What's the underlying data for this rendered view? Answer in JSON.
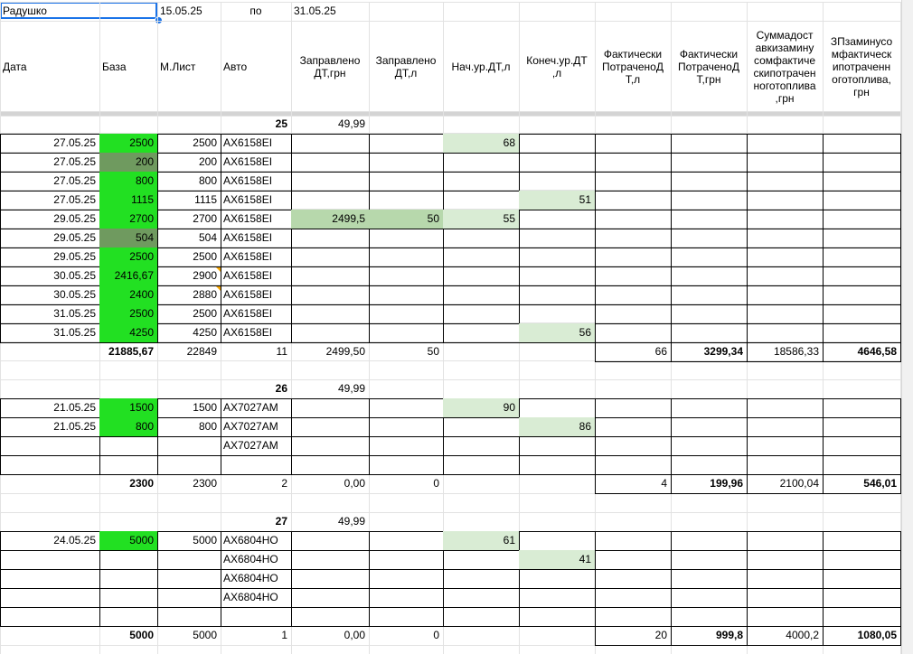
{
  "colors": {
    "grid": "#e2e2e2",
    "base_bright": "#22e022",
    "base_dark": "#6f9a5f",
    "light_fill": "#d9ecd4",
    "mid_fill": "#b7d8ac",
    "selection": "#1a73e8"
  },
  "top": {
    "name": "Радушко",
    "date_from": "15.05.25",
    "sep": "по",
    "date_to": "31.05.25"
  },
  "headers": [
    "Дата",
    "База",
    "М.Лист",
    "Авто",
    "Заправлено ДТ,грн",
    "Заправлено ДТ,л",
    "Нач.ур.ДТ,л",
    "Конеч.ур.ДТ ,л",
    "Фактически ПотраченоД Т,л",
    "Фактически ПотраченоД Т,грн",
    "Суммадост авкизамину сомфактиче скипотрачен ноготоплива ,грн",
    "ЗПзаминусо мфактическ ипотраченн оготоплива, грн"
  ],
  "groups": [
    {
      "number": "25",
      "price": "49,99",
      "rows": [
        {
          "date": "27.05.25",
          "base": "2500",
          "sheet": "2500",
          "auto": "AX6158EI",
          "fuel_uah": "",
          "fuel_l": "",
          "start": "68",
          "end": ""
        },
        {
          "date": "27.05.25",
          "base": "200",
          "sheet": "200",
          "auto": "AX6158EI",
          "fuel_uah": "",
          "fuel_l": "",
          "start": "",
          "end": ""
        },
        {
          "date": "27.05.25",
          "base": "800",
          "sheet": "800",
          "auto": "AX6158EI",
          "fuel_uah": "",
          "fuel_l": "",
          "start": "",
          "end": ""
        },
        {
          "date": "27.05.25",
          "base": "1115",
          "sheet": "1115",
          "auto": "AX6158EI",
          "fuel_uah": "",
          "fuel_l": "",
          "start": "",
          "end": "51"
        },
        {
          "date": "29.05.25",
          "base": "2700",
          "sheet": "2700",
          "auto": "AX6158EI",
          "fuel_uah": "2499,5",
          "fuel_l": "50",
          "start": "55",
          "end": ""
        },
        {
          "date": "29.05.25",
          "base": "504",
          "sheet": "504",
          "auto": "AX6158EI",
          "fuel_uah": "",
          "fuel_l": "",
          "start": "",
          "end": ""
        },
        {
          "date": "29.05.25",
          "base": "2500",
          "sheet": "2500",
          "auto": "AX6158EI",
          "fuel_uah": "",
          "fuel_l": "",
          "start": "",
          "end": ""
        },
        {
          "date": "30.05.25",
          "base": "2416,67",
          "sheet": "2900",
          "auto": "AX6158EI",
          "fuel_uah": "",
          "fuel_l": "",
          "start": "",
          "end": ""
        },
        {
          "date": "30.05.25",
          "base": "2400",
          "sheet": "2880",
          "auto": "AX6158EI",
          "fuel_uah": "",
          "fuel_l": "",
          "start": "",
          "end": ""
        },
        {
          "date": "31.05.25",
          "base": "2500",
          "sheet": "2500",
          "auto": "AX6158EI",
          "fuel_uah": "",
          "fuel_l": "",
          "start": "",
          "end": ""
        },
        {
          "date": "31.05.25",
          "base": "4250",
          "sheet": "4250",
          "auto": "AX6158EI",
          "fuel_uah": "",
          "fuel_l": "",
          "start": "",
          "end": "56"
        }
      ],
      "total": {
        "base": "21885,67",
        "sheet": "22849",
        "count": "11",
        "fuel_uah": "2499,50",
        "fuel_l": "50",
        "spent_l": "66",
        "spent_uah": "3299,34",
        "delivery": "18586,33",
        "salary": "4646,58"
      }
    },
    {
      "number": "26",
      "price": "49,99",
      "rows": [
        {
          "date": "21.05.25",
          "base": "1500",
          "sheet": "1500",
          "auto": "AX7027AM",
          "fuel_uah": "",
          "fuel_l": "",
          "start": "90",
          "end": ""
        },
        {
          "date": "21.05.25",
          "base": "800",
          "sheet": "800",
          "auto": "AX7027AM",
          "fuel_uah": "",
          "fuel_l": "",
          "start": "",
          "end": "86"
        },
        {
          "date": "",
          "base": "",
          "sheet": "",
          "auto": "AX7027AM",
          "fuel_uah": "",
          "fuel_l": "",
          "start": "",
          "end": ""
        },
        {
          "date": "",
          "base": "",
          "sheet": "",
          "auto": "",
          "fuel_uah": "",
          "fuel_l": "",
          "start": "",
          "end": ""
        }
      ],
      "total": {
        "base": "2300",
        "sheet": "2300",
        "count": "2",
        "fuel_uah": "0,00",
        "fuel_l": "0",
        "spent_l": "4",
        "spent_uah": "199,96",
        "delivery": "2100,04",
        "salary": "546,01"
      }
    },
    {
      "number": "27",
      "price": "49,99",
      "rows": [
        {
          "date": "24.05.25",
          "base": "5000",
          "sheet": "5000",
          "auto": "AX6804HO",
          "fuel_uah": "",
          "fuel_l": "",
          "start": "61",
          "end": ""
        },
        {
          "date": "",
          "base": "",
          "sheet": "",
          "auto": "AX6804HO",
          "fuel_uah": "",
          "fuel_l": "",
          "start": "",
          "end": "41"
        },
        {
          "date": "",
          "base": "",
          "sheet": "",
          "auto": "AX6804HO",
          "fuel_uah": "",
          "fuel_l": "",
          "start": "",
          "end": ""
        },
        {
          "date": "",
          "base": "",
          "sheet": "",
          "auto": "AX6804HO",
          "fuel_uah": "",
          "fuel_l": "",
          "start": "",
          "end": ""
        },
        {
          "date": "",
          "base": "",
          "sheet": "",
          "auto": "",
          "fuel_uah": "",
          "fuel_l": "",
          "start": "",
          "end": ""
        }
      ],
      "total": {
        "base": "5000",
        "sheet": "5000",
        "count": "1",
        "fuel_uah": "0,00",
        "fuel_l": "0",
        "spent_l": "20",
        "spent_uah": "999,8",
        "delivery": "4000,2",
        "salary": "1080,05"
      }
    }
  ]
}
